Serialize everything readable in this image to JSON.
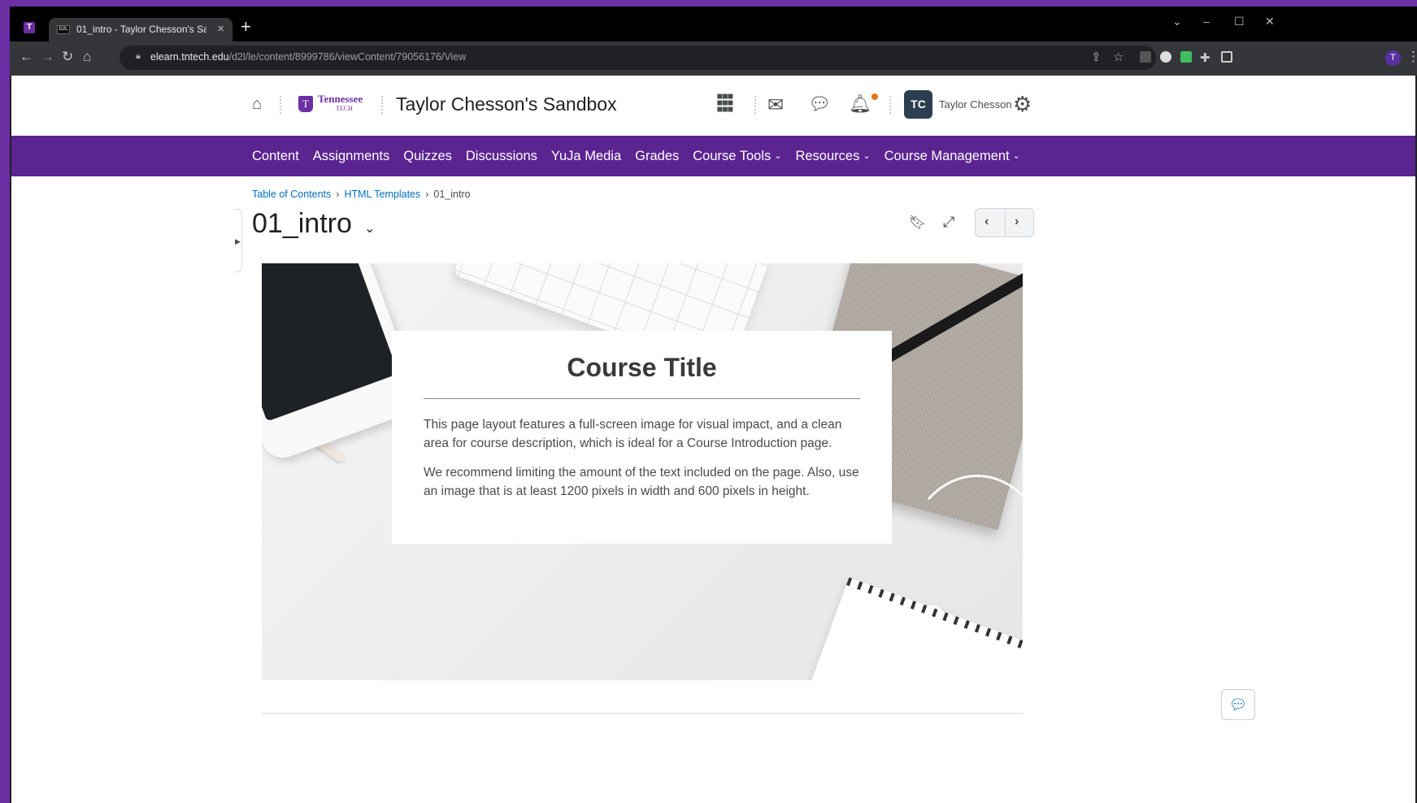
{
  "browser": {
    "tab_title": "01_intro - Taylor Chesson's Sandbox",
    "tab_favicon": "D2L",
    "new_tab_label": "+",
    "url_host": "elearn.tntech.edu",
    "url_path": "/d2l/le/content/8999786/viewContent/79056176/View",
    "profile_initial": "T"
  },
  "header": {
    "course_title": "Taylor Chesson's Sandbox",
    "logo_line1": "Tennessee",
    "logo_line2": "TECH",
    "avatar_initials": "TC",
    "user_name": "Taylor Chesson"
  },
  "nav": {
    "items": [
      {
        "label": "Content",
        "dropdown": false
      },
      {
        "label": "Assignments",
        "dropdown": false
      },
      {
        "label": "Quizzes",
        "dropdown": false
      },
      {
        "label": "Discussions",
        "dropdown": false
      },
      {
        "label": "YuJa Media",
        "dropdown": false
      },
      {
        "label": "Grades",
        "dropdown": false
      },
      {
        "label": "Course Tools",
        "dropdown": true
      },
      {
        "label": "Resources",
        "dropdown": true
      },
      {
        "label": "Course Management",
        "dropdown": true
      }
    ]
  },
  "breadcrumb": {
    "items": [
      "Table of Contents",
      "HTML Templates"
    ],
    "current": "01_intro"
  },
  "topic": {
    "title": "01_intro"
  },
  "card": {
    "title": "Course Title",
    "p1": "This page layout features a full-screen image for visual impact, and a clean area for course description, which is ideal for a Course Introduction page.",
    "p2": "We recommend limiting the amount of the text included on the page. Also, use an image that is at least 1200 pixels in width and 600 pixels in height."
  },
  "colors": {
    "brand_purple": "#5b2491",
    "link_blue": "#006fbf",
    "notification_dot": "#e87511"
  },
  "icons": [
    "home-icon",
    "waffle-grid-icon",
    "mail-icon",
    "chat-bubbles-icon",
    "bell-icon",
    "gear-icon",
    "bookmark-icon",
    "fullscreen-icon",
    "chevron-left-icon",
    "chevron-right-icon"
  ]
}
